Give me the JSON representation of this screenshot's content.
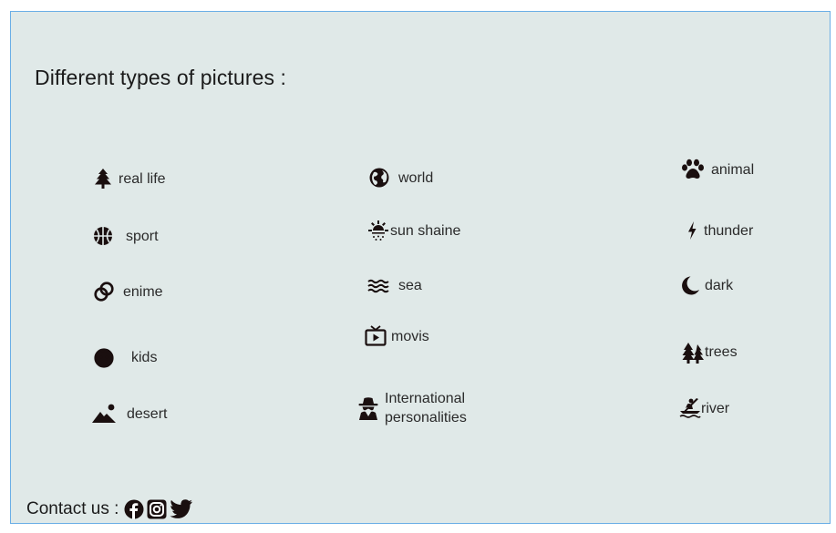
{
  "heading": "Different types of pictures :",
  "categories": [
    {
      "label": "real life",
      "icon": "tree-icon"
    },
    {
      "label": "sport",
      "icon": "basketball-icon"
    },
    {
      "label": "enime",
      "icon": "rings-icon"
    },
    {
      "label": "kids",
      "icon": "child-face-icon"
    },
    {
      "label": "desert",
      "icon": "mountain-sun-icon"
    },
    {
      "label": "world",
      "icon": "globe-icon"
    },
    {
      "label": "sun shaine",
      "icon": "sun-rain-icon"
    },
    {
      "label": "sea",
      "icon": "water-waves-icon"
    },
    {
      "label": "movis",
      "icon": "tv-icon"
    },
    {
      "label": "International personalities",
      "icon": "spy-icon"
    },
    {
      "label": "animal",
      "icon": "paw-icon"
    },
    {
      "label": "thunder",
      "icon": "bolt-icon"
    },
    {
      "label": "dark",
      "icon": "moon-icon"
    },
    {
      "label": "trees",
      "icon": "pine-trees-icon"
    },
    {
      "label": "river",
      "icon": "kayak-icon"
    }
  ],
  "footer": {
    "contact_label": "Contact us :",
    "social": [
      {
        "name": "facebook-icon"
      },
      {
        "name": "instagram-icon"
      },
      {
        "name": "twitter-icon"
      }
    ]
  },
  "colors": {
    "panel_background": "#e0e9e8",
    "panel_border": "#6aaee6",
    "icon": "#1a0f0f",
    "text": "#2a2a2a"
  }
}
